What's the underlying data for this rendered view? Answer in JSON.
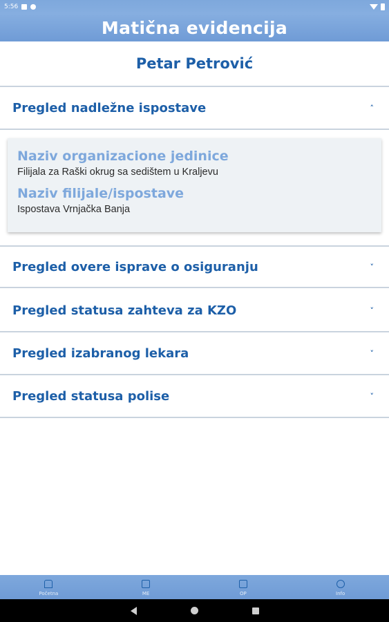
{
  "status_bar": {
    "time": "5:56"
  },
  "app": {
    "title": "Matična evidencija"
  },
  "user": {
    "name": "Petar Petrović"
  },
  "sections": [
    {
      "title": "Pregled nadležne ispostave",
      "chevron": "˄",
      "expanded": true
    },
    {
      "title": "Pregled overe isprave o osiguranju",
      "chevron": "˅",
      "expanded": false
    },
    {
      "title": "Pregled statusa zahteva za KZO",
      "chevron": "˅",
      "expanded": false
    },
    {
      "title": "Pregled izabranog lekara",
      "chevron": "˅",
      "expanded": false
    },
    {
      "title": "Pregled statusa polise",
      "chevron": "˅",
      "expanded": false
    }
  ],
  "details": {
    "org_unit_label": "Naziv organizacione jedinice",
    "org_unit_value": "Filijala za Raški okrug sa sedištem u Kraljevu",
    "branch_label": "Naziv filijale/ispostave",
    "branch_value": "Ispostava Vrnjačka Banja"
  },
  "bottom_nav": [
    {
      "label": "Početna",
      "icon": "home-icon"
    },
    {
      "label": "ME",
      "icon": "id-card-icon"
    },
    {
      "label": "OP",
      "icon": "document-icon"
    },
    {
      "label": "Info",
      "icon": "info-icon"
    }
  ],
  "colors": {
    "primary": "#1d5fa8",
    "accent_light": "#7ea8dc",
    "header_bg": "#86aee0"
  }
}
